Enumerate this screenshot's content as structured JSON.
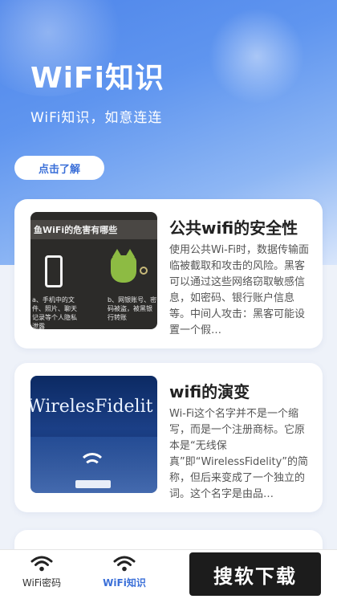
{
  "hero": {
    "title": "WiFi知识",
    "subtitle": "WiFi知识，如意连连",
    "button_label": "点击了解"
  },
  "articles": [
    {
      "title": "公共wifi的安全性",
      "text": "使用公共Wi-Fi时，数据传输面临被截取和攻击的风险。黑客可以通过这些网络窃取敏感信息，如密码、银行账户信息等。中间人攻击：黑客可能设置一个假…",
      "thumb_banner": "鱼WiFi的危害有哪些",
      "thumb_caption_left": "a、手机中的文件、照片、聊天记录等个人隐私泄露",
      "thumb_caption_right": "b、网银账号、密码被盗，被黑银行转账"
    },
    {
      "title": "wifi的演变",
      "text": "Wi-Fi这个名字并不是一个缩写，而是一个注册商标。它原本是“无线保真”即“WirelessFidelity”的简称，但后来变成了一个独立的词。这个名字是由品…",
      "thumb_label": "WirelesFidelit"
    }
  ],
  "tabbar": {
    "tabs": [
      {
        "label": "WiFi密码",
        "icon": "wifi-icon",
        "active": false
      },
      {
        "label": "WiFi知识",
        "icon": "wifi-icon",
        "active": true
      }
    ]
  },
  "watermark": {
    "text": "搜软下载"
  },
  "colors": {
    "accent": "#3a6fd8",
    "hero_top": "#4f86ea",
    "page_bg": "#eef2f9"
  }
}
